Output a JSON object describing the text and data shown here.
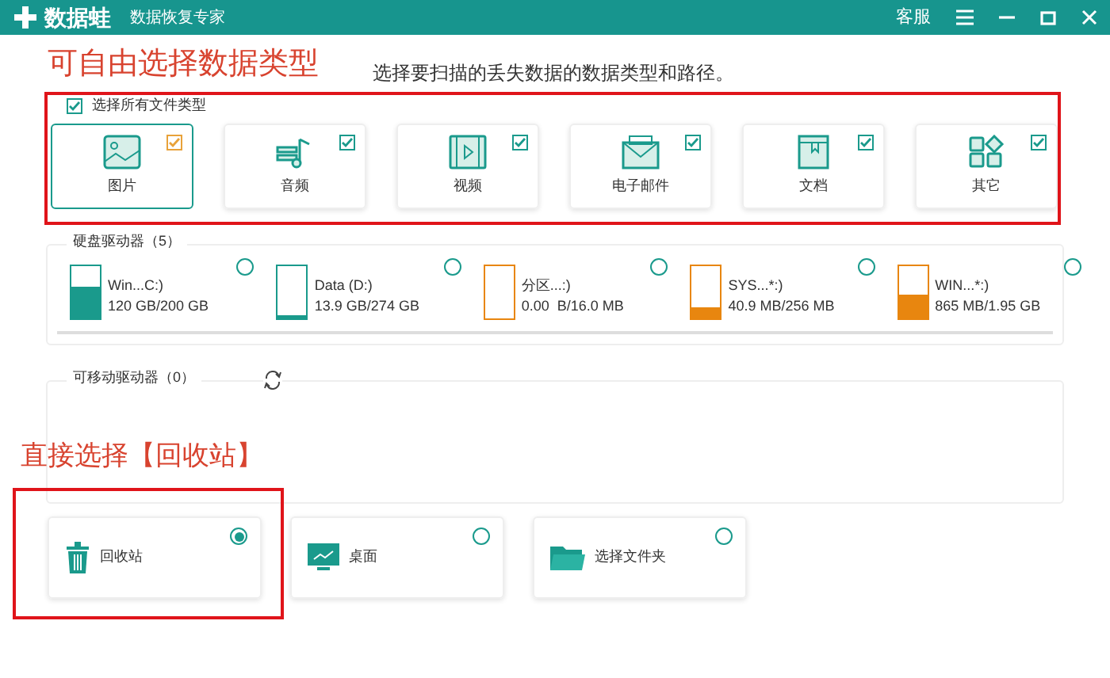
{
  "window": {
    "app_name": "数据蛙",
    "subtitle": "数据恢复专家",
    "service": "客服"
  },
  "annotations": [
    "可自由选择数据类型",
    "直接选择【回收站】"
  ],
  "instruction": "选择要扫描的丢失数据的数据类型和路径。",
  "select_all": {
    "label": "选择所有文件类型",
    "checked": true
  },
  "file_types": [
    {
      "label": "图片",
      "checked": true,
      "selected": true
    },
    {
      "label": "音频",
      "checked": true,
      "selected": false
    },
    {
      "label": "视频",
      "checked": true,
      "selected": false
    },
    {
      "label": "电子邮件",
      "checked": true,
      "selected": false
    },
    {
      "label": "文档",
      "checked": true,
      "selected": false
    },
    {
      "label": "其它",
      "checked": true,
      "selected": false
    }
  ],
  "hard_drives": {
    "title": "硬盘驱动器（5）",
    "drives": [
      {
        "name": "Win...C:)",
        "usage": "120 GB/200 GB",
        "level": 0.6,
        "color": "#1a9a8c",
        "selected": false
      },
      {
        "name": "Data (D:)",
        "usage": "13.9 GB/274 GB",
        "level": 0.06,
        "color": "#1a9a8c",
        "selected": false
      },
      {
        "name": "分区...:)",
        "usage": "0.00  B/16.0 MB",
        "color": "#e8860f",
        "selected": false
      },
      {
        "name": "SYS...*:)",
        "usage": "40.9 MB/256 MB",
        "level": 0.2,
        "color": "#e8860f",
        "selected": false
      },
      {
        "name": "WIN...*:)",
        "usage": "865 MB/1.95 GB",
        "level": 0.45,
        "color": "#e8860f",
        "selected": false
      }
    ]
  },
  "removable_drives": {
    "title": "可移动驱动器（0）"
  },
  "locations": [
    {
      "label": "回收站",
      "selected": true
    },
    {
      "label": "桌面",
      "selected": false
    },
    {
      "label": "选择文件夹",
      "selected": false
    }
  ]
}
